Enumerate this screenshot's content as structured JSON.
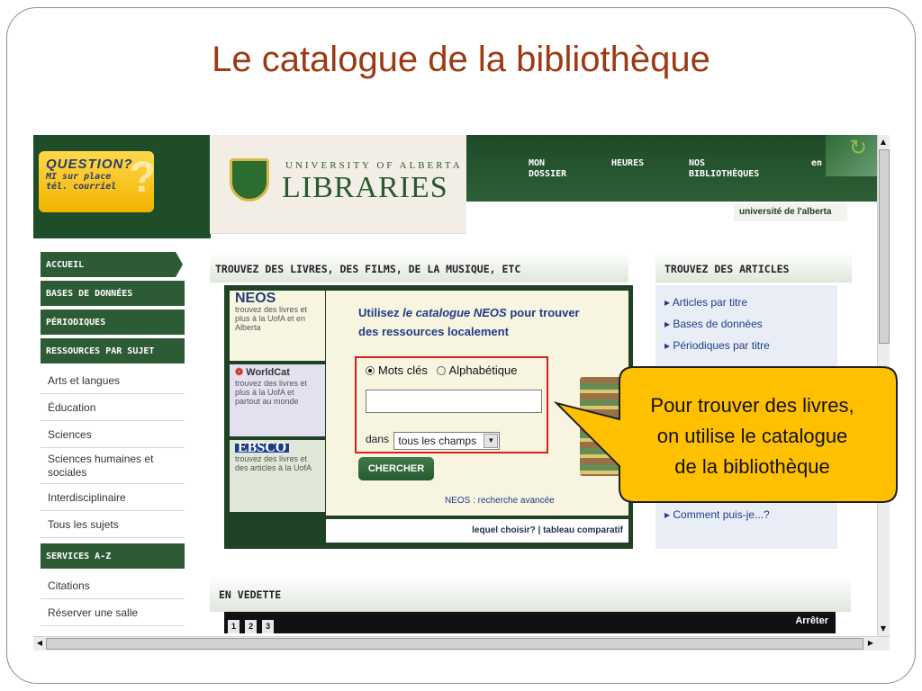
{
  "slide": {
    "title": "Le catalogue de la bibliothèque"
  },
  "question_box": {
    "title": "QUESTION?",
    "line1": "MI  sur place",
    "line2": "tél.  courriel",
    "mark": "?"
  },
  "logo": {
    "small": "UNIVERSITY OF ALBERTA",
    "big": "LIBRARIES"
  },
  "top_nav": [
    {
      "line1": "MON",
      "line2": "DOSSIER"
    },
    {
      "line1": "",
      "line2": "HEURES"
    },
    {
      "line1": "NOS",
      "line2": "BIBLIOTHÈQUES"
    },
    {
      "line1": "",
      "line2": "en"
    }
  ],
  "uofa_tag": "université de l'alberta",
  "sidebar": {
    "headers": [
      "ACCUEIL",
      "BASES DE DONNÉES",
      "PÉRIODIQUES",
      "RESSOURCES PAR SUJET",
      "SERVICES A-Z"
    ],
    "subjects": [
      "Arts et langues",
      "Éducation",
      "Sciences",
      "Sciences humaines et sociales",
      "Interdisciplinaire",
      "Tous les sujets"
    ],
    "services": [
      "Citations",
      "Réserver une salle"
    ]
  },
  "main": {
    "heading": "TROUVEZ DES LIVRES, DES FILMS, DE LA MUSIQUE, ETC",
    "engines": [
      {
        "name": "NEOS",
        "desc": "trouvez des livres et plus à la UofA et en Alberta"
      },
      {
        "name": "WorldCat",
        "desc": "trouvez des livres et plus à la UofA et partout au monde"
      },
      {
        "name": "EBSCO",
        "desc": "trouvez des livres et des articles à la UofA"
      }
    ],
    "intro_a": "Utilisez ",
    "intro_em": "le catalogue NEOS",
    "intro_b": " pour trouver des ressources localement",
    "radio_keywords": "Mots clés",
    "radio_alpha": "Alphabétique",
    "search_value": "",
    "in_label": "dans",
    "select_value": "tous les champs",
    "search_button": "CHERCHER",
    "advanced_link": "NEOS : recherche avancée",
    "footer": "lequel choisir? | tableau comparatif"
  },
  "articles": {
    "heading": "TROUVEZ DES ARTICLES",
    "items": [
      "Articles par titre",
      "Bases de données",
      "Périodiques par titre"
    ],
    "last": "Comment puis-je...?"
  },
  "featured": {
    "heading": "EN VEDETTE",
    "pages": [
      "1",
      "2",
      "3"
    ],
    "stop": "Arrêter"
  },
  "callout": {
    "line1": "Pour trouver des livres,",
    "line2": "on utilise le catalogue",
    "line3": "de la bibliothèque",
    "fill": "#ffc000",
    "stroke": "#1f1f1f"
  },
  "colors": {
    "brand_green": "#2d5b35",
    "title_red": "#9c3a14",
    "highlight_red": "#d42020"
  }
}
